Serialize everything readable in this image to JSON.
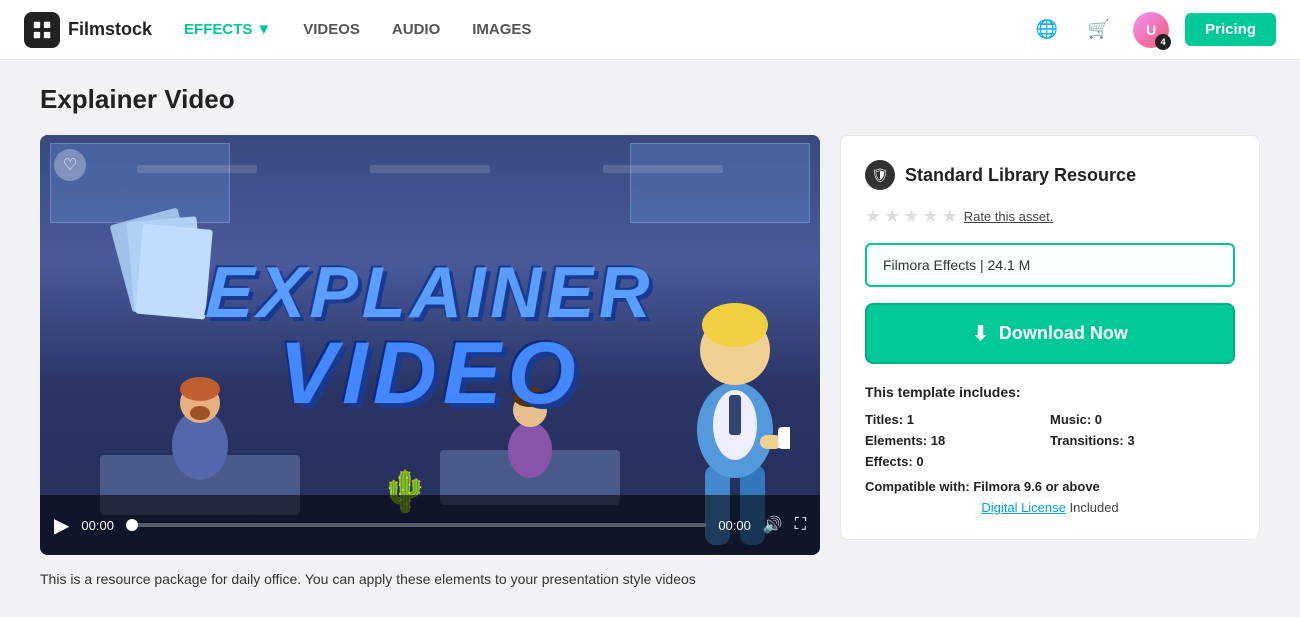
{
  "header": {
    "logo_text": "Filmstock",
    "nav_items": [
      {
        "label": "EFFECTS",
        "active": true,
        "has_arrow": true
      },
      {
        "label": "VIDEOS",
        "active": false,
        "has_arrow": false
      },
      {
        "label": "AUDIO",
        "active": false,
        "has_arrow": false
      },
      {
        "label": "IMAGES",
        "active": false,
        "has_arrow": false
      }
    ],
    "pricing_label": "Pricing"
  },
  "page": {
    "title": "Explainer Video"
  },
  "video": {
    "title_line1": "EXPLAINER",
    "title_line2": "VIDEO",
    "time_current": "00:00",
    "time_end": "00:00"
  },
  "sidebar": {
    "resource_type": "Standard Library Resource",
    "rate_text": "Rate this asset.",
    "file_info": "Filmora Effects | 24.1 M",
    "download_label": "Download Now",
    "includes_title": "This template includes:",
    "titles_label": "Titles:",
    "titles_value": "1",
    "music_label": "Music:",
    "music_value": "0",
    "elements_label": "Elements:",
    "elements_value": "18",
    "transitions_label": "Transitions:",
    "transitions_value": "3",
    "effects_label": "Effects:",
    "effects_value": "0",
    "compatible_label": "Compatible with:",
    "compatible_value": "Filmora 9.6 or above",
    "license_link": "Digital License",
    "license_suffix": " Included"
  },
  "description": {
    "text": "This is a resource package for daily office. You can apply these elements to your presentation style videos"
  }
}
